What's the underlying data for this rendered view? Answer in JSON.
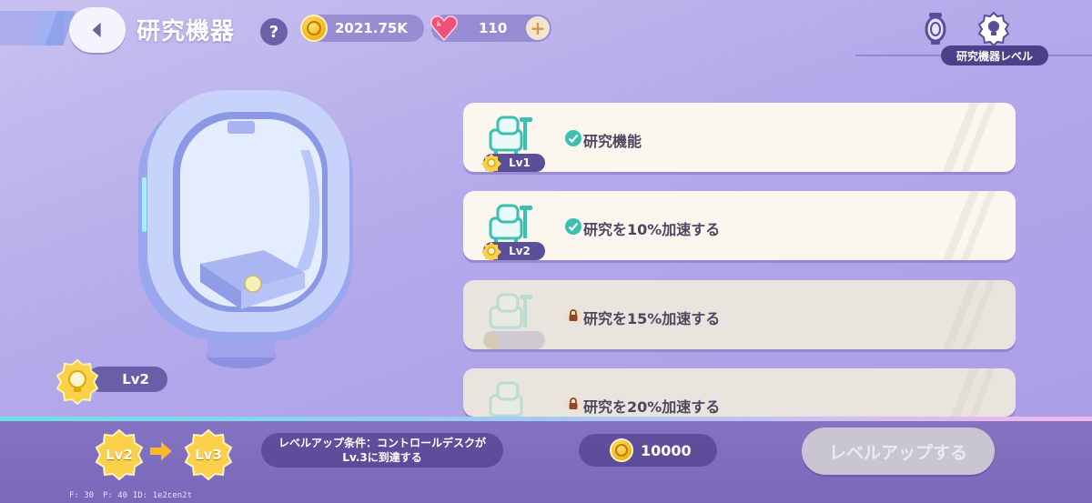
{
  "header": {
    "title": "研究機器",
    "help_label": "?",
    "coins": "2021.75K",
    "gems": "110",
    "plus_label": "+",
    "level_tab": "研究機器レベル"
  },
  "machine": {
    "level": "Lv2"
  },
  "upgrades": [
    {
      "level": "Lv1",
      "text": "研究機能",
      "status": "unlocked"
    },
    {
      "level": "Lv2",
      "text": "研究を10%加速する",
      "status": "unlocked"
    },
    {
      "level": "",
      "text": "研究を15%加速する",
      "status": "locked"
    },
    {
      "level": "",
      "text": "研究を20%加速する",
      "status": "locked"
    }
  ],
  "footer": {
    "current_level": "Lv2",
    "next_level": "Lv3",
    "condition_line1": "レベルアップ条件：コントロールデスクが",
    "condition_line2": "Lv.3に到達する",
    "cost": "10000",
    "levelup_label": "レベルアップする"
  },
  "debug": {
    "fps": "F: 30",
    "ping": "P: 40",
    "id": "ID: 1e2cen2t"
  },
  "colors": {
    "accent": "#6a5ea8",
    "check": "#3bbfb0",
    "coin": "#f3b414",
    "gem": "#f0517a"
  }
}
